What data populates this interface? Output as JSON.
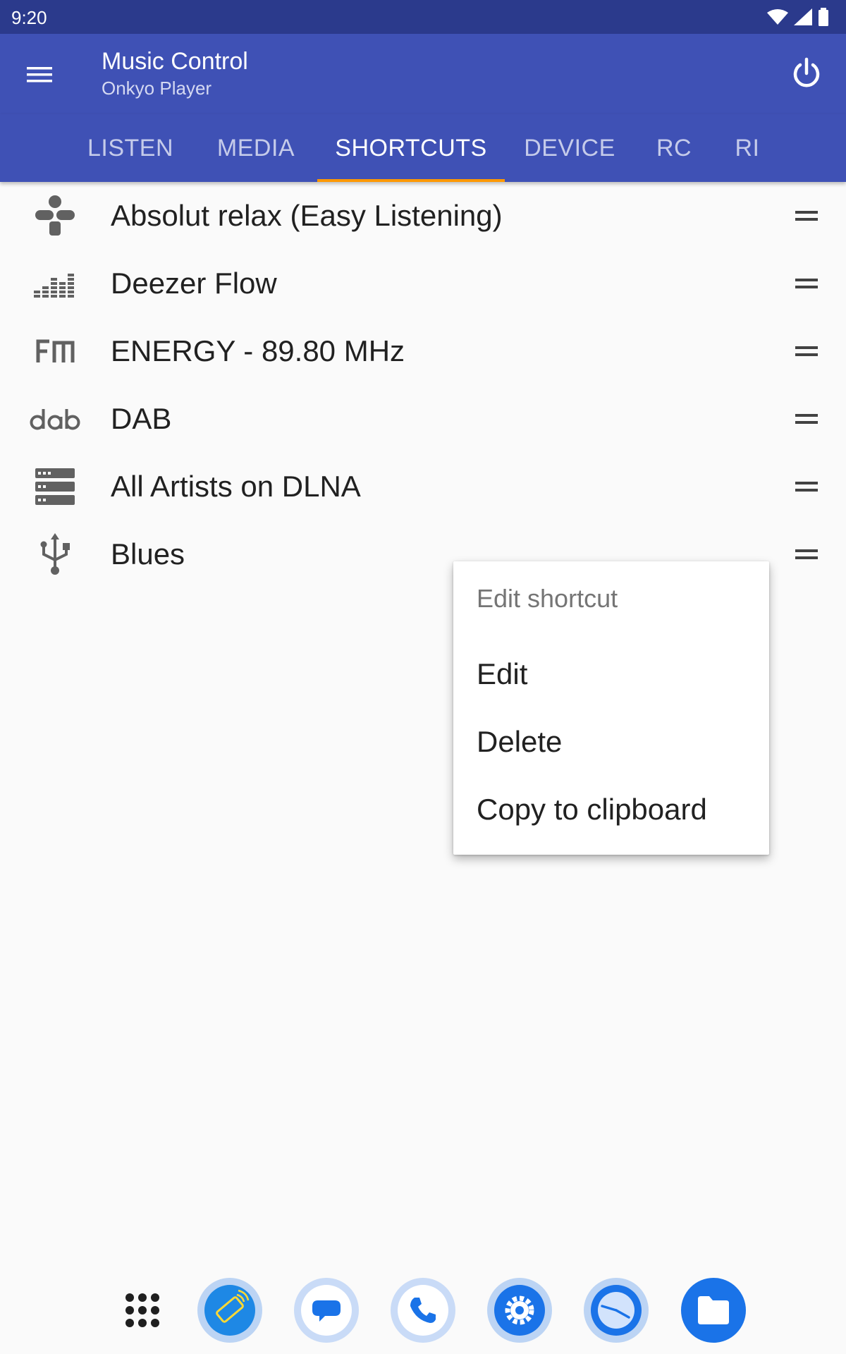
{
  "status_bar": {
    "time": "9:20",
    "icons": [
      "wifi-icon",
      "signal-icon",
      "battery-icon"
    ]
  },
  "app_bar": {
    "title": "Music Control",
    "subtitle": "Onkyo Player",
    "menu_icon": "menu-icon",
    "power_icon": "power-icon"
  },
  "tabs": [
    {
      "label": "LISTEN",
      "active": false
    },
    {
      "label": "MEDIA",
      "active": false
    },
    {
      "label": "SHORTCUTS",
      "active": true
    },
    {
      "label": "DEVICE",
      "active": false
    },
    {
      "label": "RC",
      "active": false
    },
    {
      "label": "RI",
      "active": false
    }
  ],
  "shortcuts": [
    {
      "label": "Absolut relax (Easy Listening)",
      "icon": "tunein-icon"
    },
    {
      "label": "Deezer Flow",
      "icon": "deezer-icon"
    },
    {
      "label": "ENERGY - 89.80 MHz",
      "icon": "fm-icon"
    },
    {
      "label": "DAB",
      "icon": "dab-icon"
    },
    {
      "label": "All Artists on DLNA",
      "icon": "server-icon"
    },
    {
      "label": "Blues",
      "icon": "usb-icon"
    }
  ],
  "popup_menu": {
    "header": "Edit shortcut",
    "items": [
      "Edit",
      "Delete",
      "Copy to clipboard"
    ]
  },
  "dock": [
    "app-drawer-icon",
    "remote-app-icon",
    "messages-icon",
    "phone-icon",
    "settings-icon",
    "clock-icon",
    "files-icon"
  ],
  "colors": {
    "primary": "#3f51b5",
    "status_bar": "#2b3a8c",
    "tab_indicator": "#ff9800",
    "background": "#fafafa"
  }
}
